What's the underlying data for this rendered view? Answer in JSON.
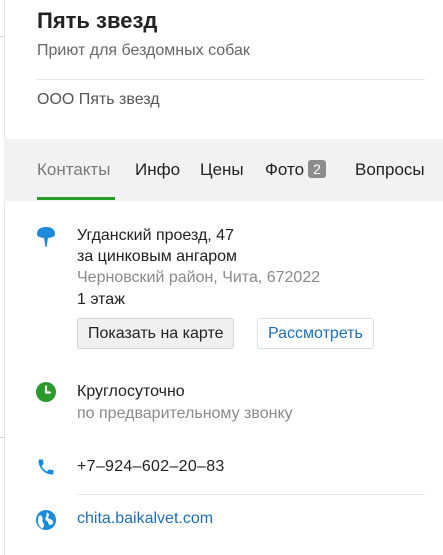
{
  "header": {
    "title": "Пять звезд",
    "subtitle": "Приют для бездомных собак",
    "company": "ООО Пять звезд"
  },
  "tabs": [
    {
      "label": "Контакты",
      "active": true
    },
    {
      "label": "Инфо"
    },
    {
      "label": "Цены"
    },
    {
      "label": "Фото",
      "badge": "2"
    },
    {
      "label": "Вопросы"
    }
  ],
  "address": {
    "line1": "Угданский проезд, 47",
    "line2": "за цинковым ангаром",
    "district": "Черновский район, Чита, 672022",
    "floor": "1 этаж",
    "show_on_map_label": "Показать на карте",
    "view_label": "Рассмотреть"
  },
  "hours": {
    "main": "Круглосуточно",
    "note": "по предварительному звонку"
  },
  "phone": "+7‒924‒602‒20‒83",
  "website": "chita.baikalvet.com",
  "colors": {
    "accent_green": "#2a9a2a",
    "link_blue": "#1f6fb5",
    "pin_blue": "#1a8cdb"
  },
  "icons": [
    "location-pin-icon",
    "clock-icon",
    "phone-icon",
    "globe-icon"
  ]
}
